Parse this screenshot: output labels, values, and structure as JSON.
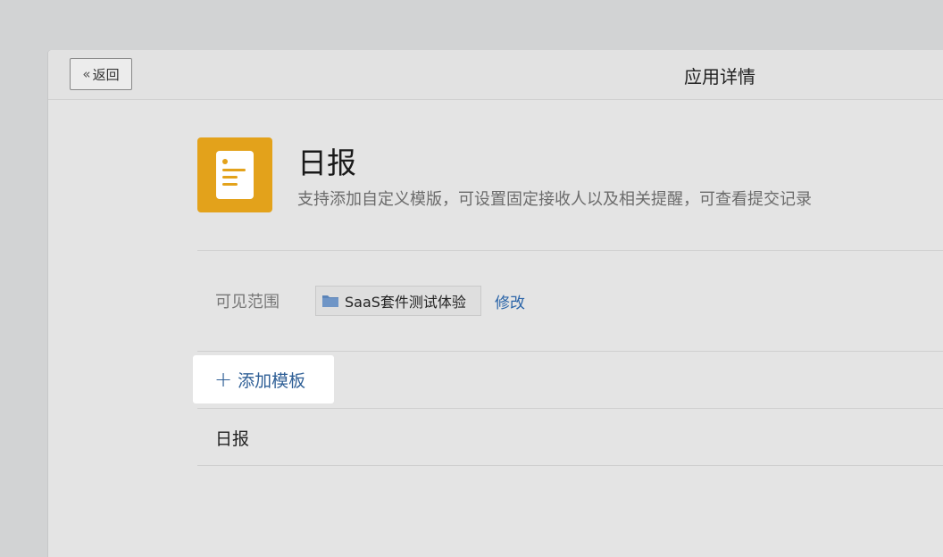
{
  "header": {
    "back_label": "返回",
    "title": "应用详情"
  },
  "app": {
    "icon": "document-icon",
    "icon_color": "#e3a21b",
    "name": "日报",
    "description": "支持添加自定义模版，可设置固定接收人以及相关提醒，可查看提交记录"
  },
  "visibility": {
    "label": "可见范围",
    "scope": "SaaS套件测试体验",
    "scope_icon": "folder-icon",
    "modify_label": "修改"
  },
  "templates": {
    "add_label": "添加模板",
    "items": [
      {
        "label": "日报"
      }
    ]
  },
  "colors": {
    "link": "#2a64a8",
    "accent": "#e3a21b"
  }
}
